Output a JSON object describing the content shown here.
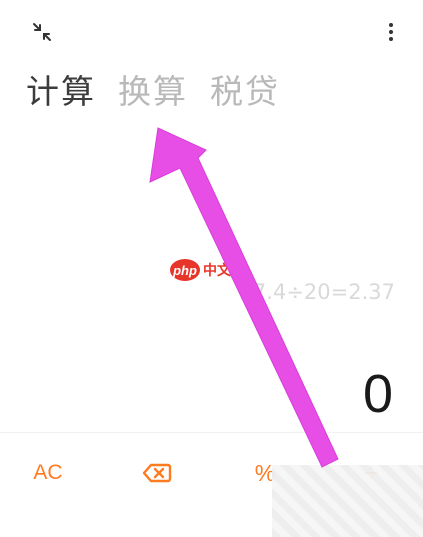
{
  "toolbar": {
    "collapse_icon": "collapse-arrows-icon",
    "menu_icon": "more-vertical-icon"
  },
  "tabs": [
    {
      "label": "计算",
      "active": true
    },
    {
      "label": "换算",
      "active": false
    },
    {
      "label": "税贷",
      "active": false
    }
  ],
  "display": {
    "expression": "47.4÷20=2.37",
    "result": "0"
  },
  "keypad": {
    "ac_label": "AC",
    "backspace_icon": "backspace-icon",
    "percent_label": "%",
    "divide_label": "÷"
  },
  "watermark": {
    "badge": "php",
    "text": "中文网"
  },
  "colors": {
    "accent": "#ff7b1f",
    "active_tab": "#3c3c3c",
    "inactive_tab": "#b9b9b9",
    "annotation_arrow": "#e64ee6"
  }
}
